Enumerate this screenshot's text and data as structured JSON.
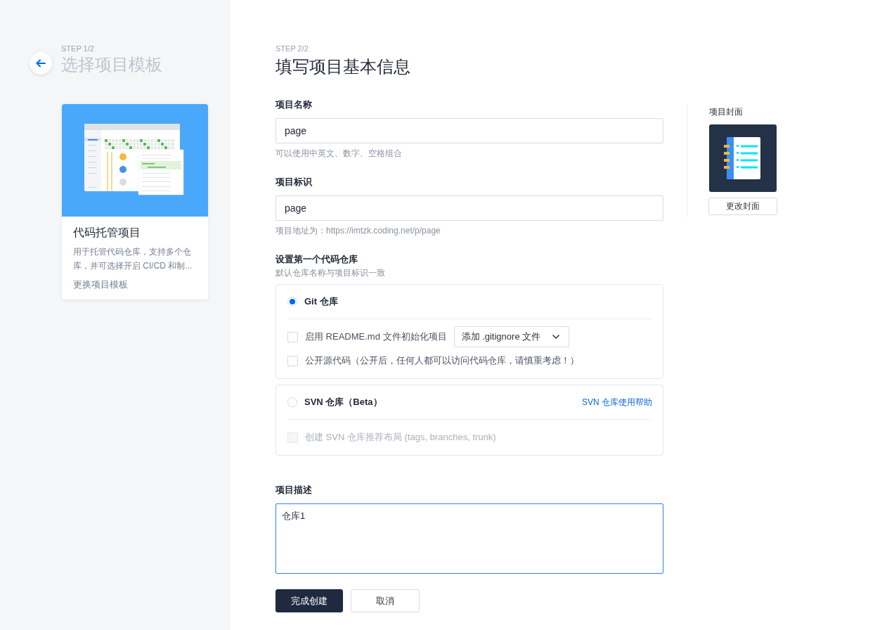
{
  "previous_step": {
    "step": "STEP 1/2",
    "title": "选择项目模板"
  },
  "template_card": {
    "title": "代码托管项目",
    "description": "用于托管代码仓库，支持多个仓库，并可选择开启 CI/CD 和制...",
    "change_link": "更换项目模板"
  },
  "form": {
    "step": "STEP 2/2",
    "title": "填写项目基本信息",
    "fields": [
      {
        "label": "项目名称",
        "value": "page",
        "hint": "可以使用中英文、数字、空格组合"
      },
      {
        "label": "项目标识",
        "value": "page",
        "hint": "项目地址为：https://imtzk.coding.net/p/page"
      }
    ],
    "repository": {
      "label": "设置第一个代码仓库",
      "hint": "默认仓库名称与项目标识一致",
      "options": [
        {
          "name": "Git 仓库",
          "selected": true,
          "settings": [
            {
              "label": "启用 README.md 文件初始化项目",
              "checked": false,
              "disabled": false,
              "dropdown": "添加 .gitignore 文件"
            },
            {
              "label": "公开源代码（公开后，任何人都可以访问代码仓库，请慎重考虑！）",
              "checked": false,
              "disabled": false
            }
          ]
        },
        {
          "name": "SVN 仓库（Beta）",
          "selected": false,
          "help_link": "SVN 仓库使用帮助",
          "settings": [
            {
              "label": "创建 SVN 仓库推荐布局 (tags, branches, trunk)",
              "checked": false,
              "disabled": true
            }
          ]
        }
      ]
    },
    "description": {
      "label": "项目描述",
      "value": "仓库1",
      "focused": true
    },
    "buttons": [
      {
        "label": "完成创建",
        "kind": "primary"
      },
      {
        "label": "取消",
        "kind": "default"
      }
    ]
  },
  "cover": {
    "label": "项目封面",
    "button": "更改封面"
  }
}
